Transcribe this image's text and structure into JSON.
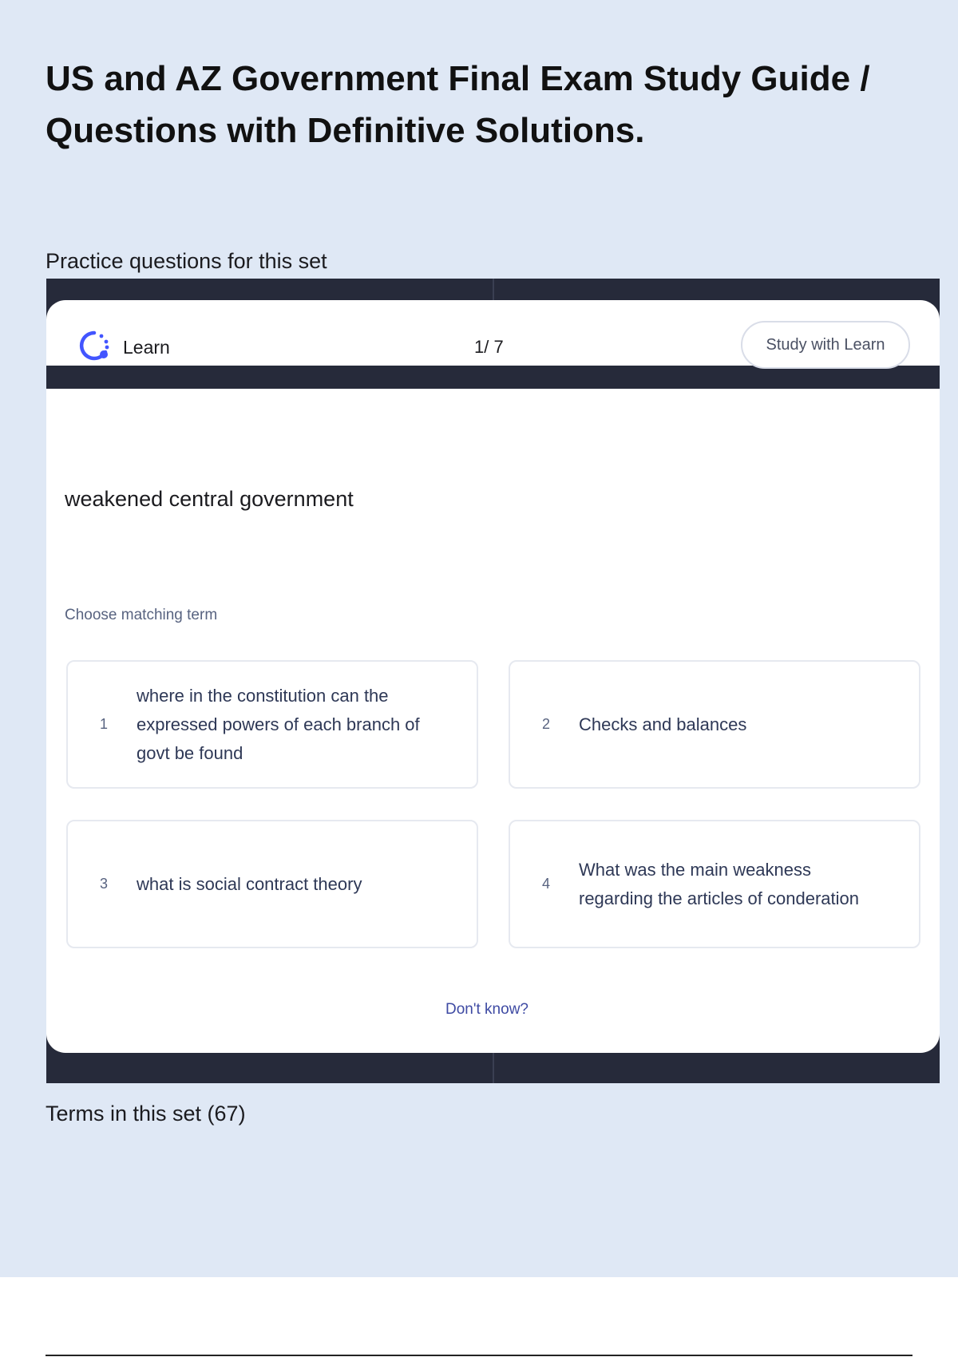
{
  "document": {
    "title": "US and AZ Government Final Exam Study Guide / Questions with Definitive Solutions.",
    "practice_label": "Practice questions for this set",
    "terms_heading": "Terms in this set (67)"
  },
  "learn_card": {
    "mode_label": "Learn",
    "mode_icon": "learn-progress-icon",
    "progress": "1/ 7",
    "study_button_label": "Study with Learn",
    "question": "weakened central government",
    "prompt": "Choose matching term",
    "options": [
      {
        "number": "1",
        "text": "where in the constitution can the expressed powers of each branch of govt be found"
      },
      {
        "number": "2",
        "text": "Checks and balances"
      },
      {
        "number": "3",
        "text": "what is social contract theory"
      },
      {
        "number": "4",
        "text": "What was the main weakness regarding the articles of conderation"
      }
    ],
    "dont_know_label": "Don't know?"
  },
  "colors": {
    "page_background": "#dfe8f5",
    "frame_background": "#262a3a",
    "accent": "#4255ff",
    "link": "#3e4aa3"
  }
}
